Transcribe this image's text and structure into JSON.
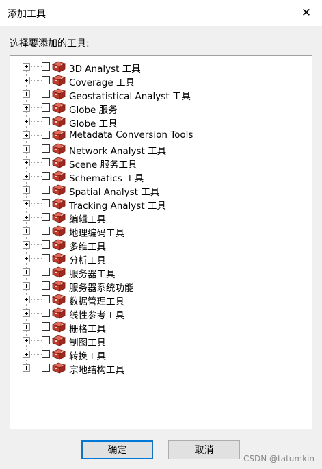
{
  "window": {
    "title": "添加工具",
    "close_glyph": "✕"
  },
  "prompt": "选择要添加的工具:",
  "tree": {
    "icon": "toolbox-icon",
    "items": [
      {
        "label": "3D Analyst 工具",
        "checked": false
      },
      {
        "label": "Coverage 工具",
        "checked": false
      },
      {
        "label": "Geostatistical Analyst 工具",
        "checked": false
      },
      {
        "label": "Globe 服务",
        "checked": false
      },
      {
        "label": "Globe 工具",
        "checked": false
      },
      {
        "label": "Metadata Conversion Tools",
        "checked": false
      },
      {
        "label": "Network Analyst 工具",
        "checked": false
      },
      {
        "label": "Scene 服务工具",
        "checked": false
      },
      {
        "label": "Schematics 工具",
        "checked": false
      },
      {
        "label": "Spatial Analyst 工具",
        "checked": false
      },
      {
        "label": "Tracking Analyst 工具",
        "checked": false
      },
      {
        "label": "编辑工具",
        "checked": false
      },
      {
        "label": "地理编码工具",
        "checked": false
      },
      {
        "label": "多维工具",
        "checked": false
      },
      {
        "label": "分析工具",
        "checked": false
      },
      {
        "label": "服务器工具",
        "checked": false
      },
      {
        "label": "服务器系统功能",
        "checked": false
      },
      {
        "label": "数据管理工具",
        "checked": false
      },
      {
        "label": "线性参考工具",
        "checked": false
      },
      {
        "label": "栅格工具",
        "checked": false
      },
      {
        "label": "制图工具",
        "checked": false
      },
      {
        "label": "转换工具",
        "checked": false
      },
      {
        "label": "宗地结构工具",
        "checked": false
      }
    ]
  },
  "buttons": {
    "ok": "确定",
    "cancel": "取消"
  },
  "watermark": "CSDN @tatumkin",
  "colors": {
    "focus": "#0078d7",
    "toolbox_red": "#c0392b"
  }
}
